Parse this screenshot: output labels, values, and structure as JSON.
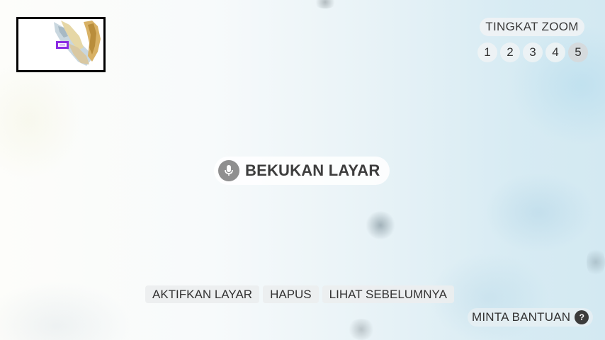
{
  "minimap": {
    "icon": "minimap-viewport-marker",
    "marker_color": "#8a2be2"
  },
  "zoom": {
    "title": "TINGKAT ZOOM",
    "levels": [
      "1",
      "2",
      "3",
      "4",
      "5"
    ],
    "active_level": "5"
  },
  "freeze": {
    "label": "BEKUKAN LAYAR",
    "icon": "mic-icon"
  },
  "toolbar": {
    "activate_label": "AKTIFKAN LAYAR",
    "delete_label": "HAPUS",
    "previous_label": "LIHAT SEBELUMNYA"
  },
  "help": {
    "label": "MINTA BANTUAN",
    "icon_glyph": "?"
  }
}
